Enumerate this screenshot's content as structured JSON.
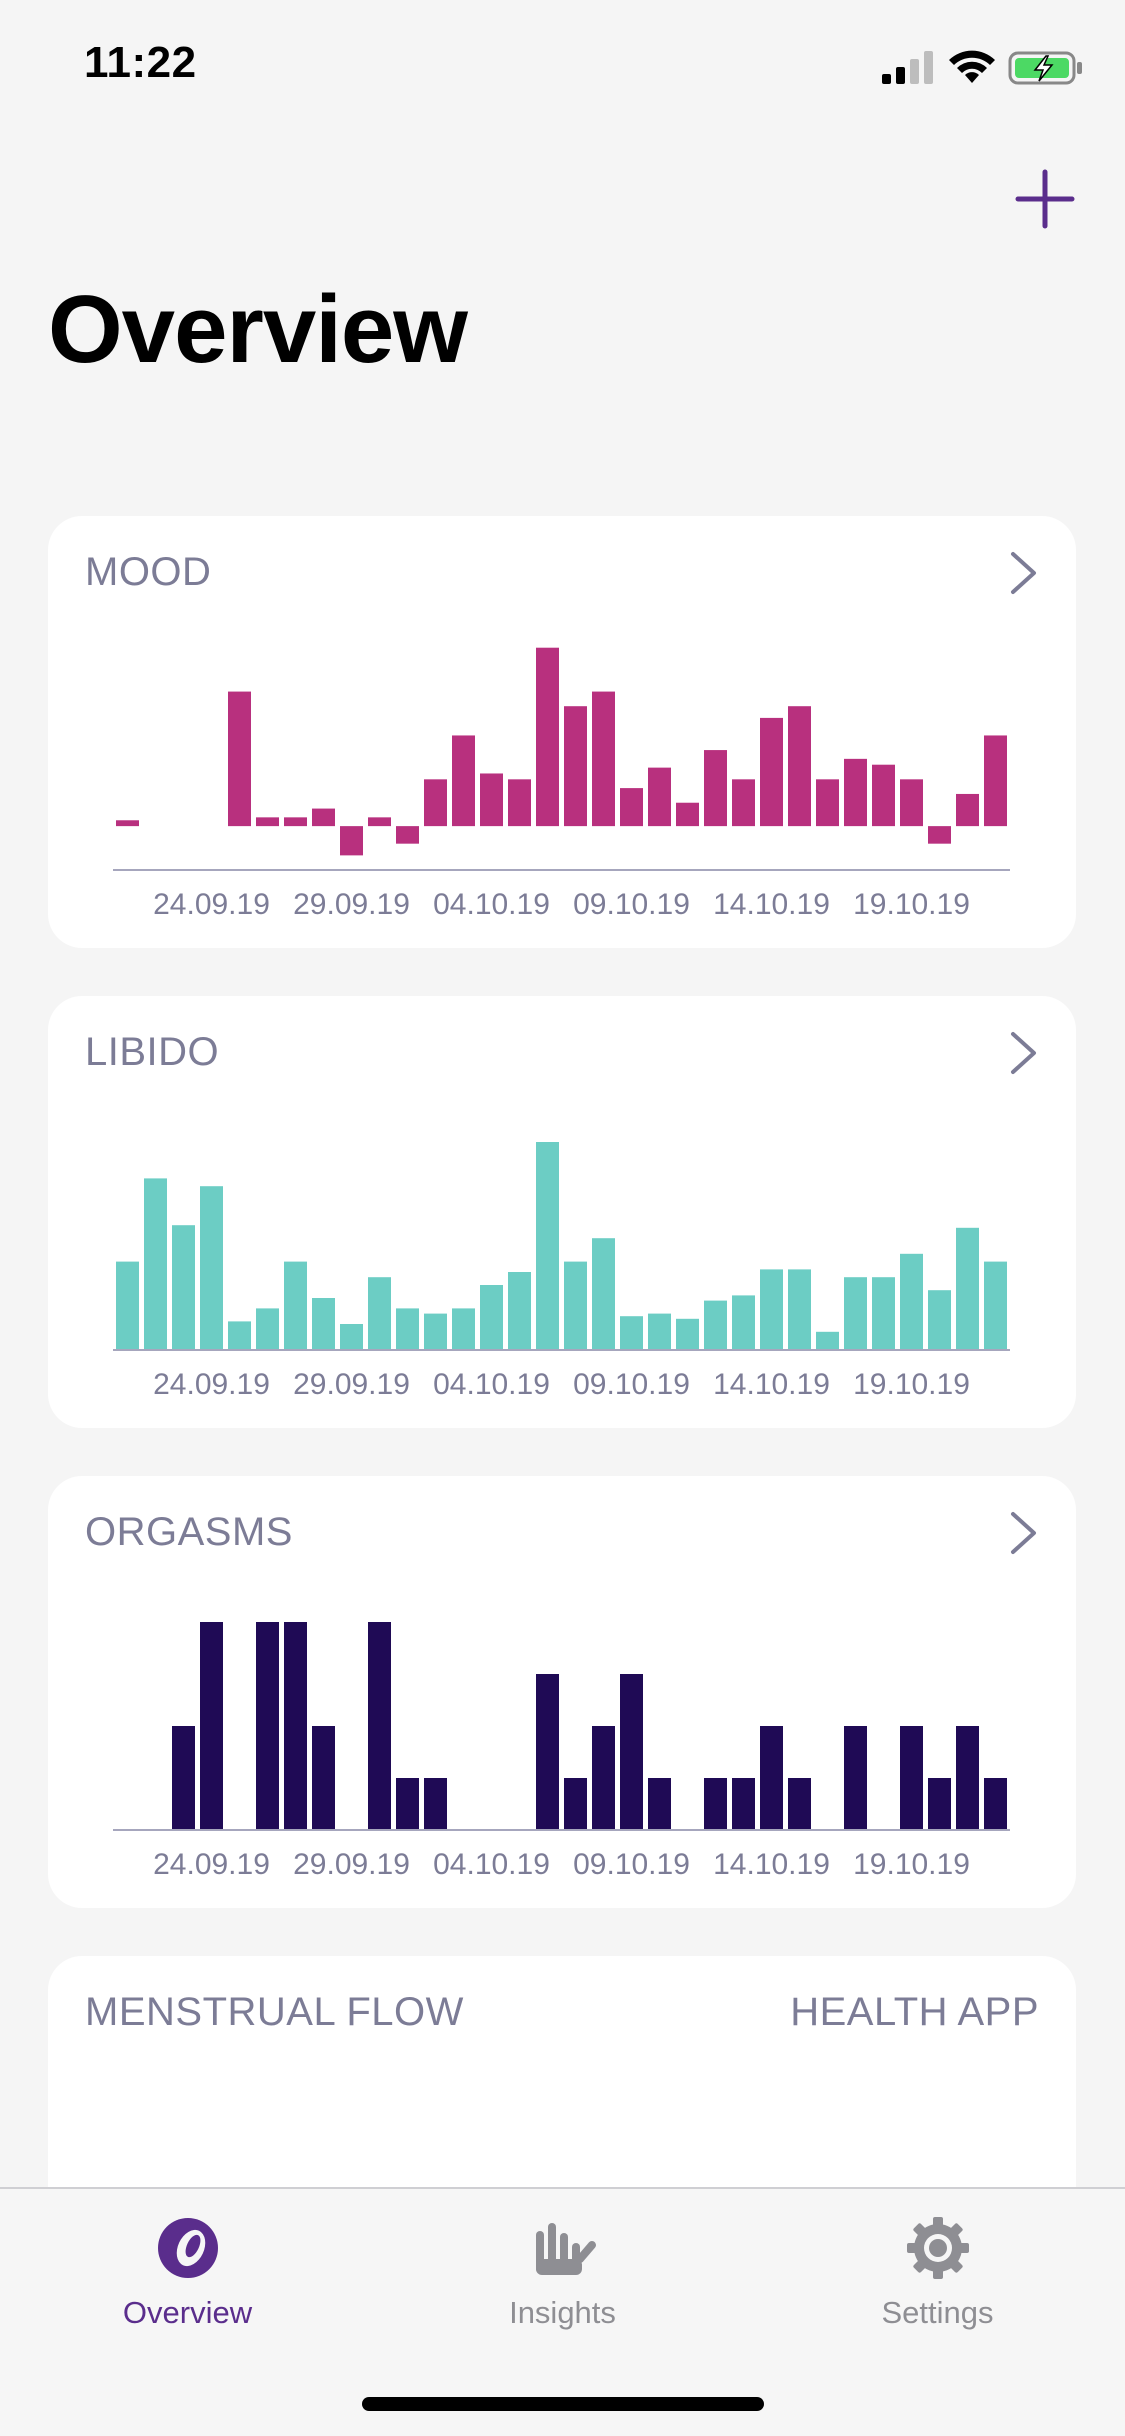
{
  "status_bar": {
    "time": "11:22"
  },
  "header": {
    "title": "Overview"
  },
  "colors": {
    "mood": "#b8307e",
    "libido": "#6ccdc4",
    "orgasms": "#1f0a55",
    "accent": "#5a2d8c",
    "label_gray": "#7c7c96"
  },
  "cards": [
    {
      "title": "MOOD",
      "chart_key": "mood"
    },
    {
      "title": "LIBIDO",
      "chart_key": "libido"
    },
    {
      "title": "ORGASMS",
      "chart_key": "orgasms"
    },
    {
      "title": "MENSTRUAL FLOW",
      "link_label": "HEALTH APP"
    }
  ],
  "chart_data": [
    {
      "type": "bar",
      "name": "mood",
      "xlabel": "",
      "ylabel": "",
      "categories": [
        "21.09.19",
        "22.09.19",
        "23.09.19",
        "24.09.19",
        "25.09.19",
        "26.09.19",
        "27.09.19",
        "28.09.19",
        "29.09.19",
        "30.09.19",
        "01.10.19",
        "02.10.19",
        "03.10.19",
        "04.10.19",
        "05.10.19",
        "06.10.19",
        "07.10.19",
        "08.10.19",
        "09.10.19",
        "10.10.19",
        "11.10.19",
        "12.10.19",
        "13.10.19",
        "14.10.19",
        "15.10.19",
        "16.10.19",
        "17.10.19",
        "18.10.19",
        "19.10.19",
        "20.10.19",
        "21.10.19",
        "22.10.19"
      ],
      "values": [
        0.2,
        null,
        null,
        null,
        4.6,
        0.3,
        0.3,
        0.6,
        -1.0,
        0.3,
        -0.6,
        1.6,
        3.1,
        1.8,
        1.6,
        6.1,
        4.1,
        4.6,
        1.3,
        2.0,
        0.8,
        2.6,
        1.6,
        3.7,
        4.1,
        1.6,
        2.3,
        2.1,
        1.6,
        -0.6,
        1.1,
        3.1
      ],
      "ylim": [
        -1.5,
        6.5
      ],
      "x_tick_labels": [
        "24.09.19",
        "29.09.19",
        "04.10.19",
        "09.10.19",
        "14.10.19",
        "19.10.19"
      ],
      "grid": false,
      "legend": "none"
    },
    {
      "type": "bar",
      "name": "libido",
      "xlabel": "",
      "ylabel": "",
      "categories": [
        "21.09.19",
        "22.09.19",
        "23.09.19",
        "24.09.19",
        "25.09.19",
        "26.09.19",
        "27.09.19",
        "28.09.19",
        "29.09.19",
        "30.09.19",
        "01.10.19",
        "02.10.19",
        "03.10.19",
        "04.10.19",
        "05.10.19",
        "06.10.19",
        "07.10.19",
        "08.10.19",
        "09.10.19",
        "10.10.19",
        "11.10.19",
        "12.10.19",
        "13.10.19",
        "14.10.19",
        "15.10.19",
        "16.10.19",
        "17.10.19",
        "18.10.19",
        "19.10.19",
        "20.10.19",
        "21.10.19",
        "22.10.19"
      ],
      "values": [
        3.4,
        6.6,
        4.8,
        6.3,
        1.1,
        1.6,
        3.4,
        2.0,
        1.0,
        2.8,
        1.6,
        1.4,
        1.6,
        2.5,
        3.0,
        8.0,
        3.4,
        4.3,
        1.3,
        1.4,
        1.2,
        1.9,
        2.1,
        3.1,
        3.1,
        0.7,
        2.8,
        2.8,
        3.7,
        2.3,
        4.7,
        3.4
      ],
      "ylim": [
        0,
        9
      ],
      "x_tick_labels": [
        "24.09.19",
        "29.09.19",
        "04.10.19",
        "09.10.19",
        "14.10.19",
        "19.10.19"
      ],
      "grid": false,
      "legend": "none"
    },
    {
      "type": "bar",
      "name": "orgasms",
      "xlabel": "",
      "ylabel": "",
      "categories": [
        "21.09.19",
        "22.09.19",
        "23.09.19",
        "24.09.19",
        "25.09.19",
        "26.09.19",
        "27.09.19",
        "28.09.19",
        "29.09.19",
        "30.09.19",
        "01.10.19",
        "02.10.19",
        "03.10.19",
        "04.10.19",
        "05.10.19",
        "06.10.19",
        "07.10.19",
        "08.10.19",
        "09.10.19",
        "10.10.19",
        "11.10.19",
        "12.10.19",
        "13.10.19",
        "14.10.19",
        "15.10.19",
        "16.10.19",
        "17.10.19",
        "18.10.19",
        "19.10.19",
        "20.10.19",
        "21.10.19",
        "22.10.19"
      ],
      "values": [
        0,
        0,
        2,
        4,
        0,
        4,
        4,
        2,
        0,
        4,
        1,
        1,
        0,
        0,
        0,
        3,
        1,
        2,
        3,
        1,
        0,
        1,
        1,
        2,
        1,
        0,
        2,
        0,
        2,
        1,
        2,
        1
      ],
      "ylim": [
        0,
        4.5
      ],
      "x_tick_labels": [
        "24.09.19",
        "29.09.19",
        "04.10.19",
        "09.10.19",
        "14.10.19",
        "19.10.19"
      ],
      "grid": false,
      "legend": "none"
    }
  ],
  "tabs": [
    {
      "label": "Overview",
      "icon": "overview-icon",
      "active": true
    },
    {
      "label": "Insights",
      "icon": "insights-icon",
      "active": false
    },
    {
      "label": "Settings",
      "icon": "gear-icon",
      "active": false
    }
  ]
}
